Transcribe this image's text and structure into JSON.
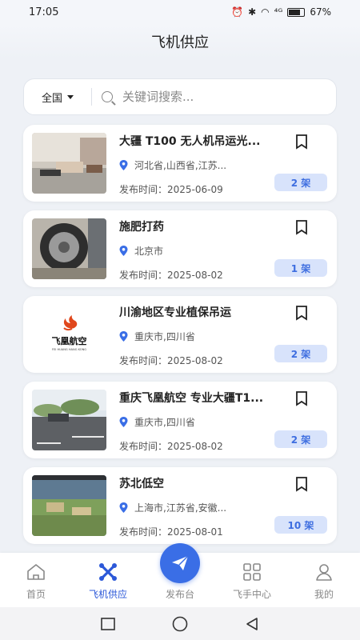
{
  "status_bar": {
    "time": "17:05",
    "network": "⁴ᴳ",
    "battery": "67%"
  },
  "header": {
    "title": "飞机供应"
  },
  "search": {
    "region": "全国",
    "placeholder": "关键词搜索..."
  },
  "listings": [
    {
      "title": "大疆 T100 无人机吊运光...",
      "location": "河北省,山西省,江苏...",
      "date": "发布时间：2025-06-09",
      "quantity": "2 架"
    },
    {
      "title": "施肥打药",
      "location": "北京市",
      "date": "发布时间：2025-08-02",
      "quantity": "1 架"
    },
    {
      "title": "川渝地区专业植保吊运",
      "location": "重庆市,四川省",
      "date": "发布时间：2025-08-02",
      "quantity": "2 架"
    },
    {
      "title": "重庆飞凰航空 专业大疆T1...",
      "location": "重庆市,四川省",
      "date": "发布时间：2025-08-02",
      "quantity": "2 架"
    },
    {
      "title": "苏北低空",
      "location": "上海市,江苏省,安徽...",
      "date": "发布时间：2025-08-01",
      "quantity": "10 架"
    }
  ],
  "logo": {
    "name": "飞凰航空",
    "sub": "FEI HUANG HANG KONG"
  },
  "tabbar": {
    "home": "首页",
    "supply": "飞机供应",
    "publish": "发布台",
    "pilot": "飞手中心",
    "mine": "我的"
  },
  "colors": {
    "accent": "#3a6ee6",
    "badge_bg": "#d8e3fb",
    "badge_text": "#3e6ee0"
  }
}
